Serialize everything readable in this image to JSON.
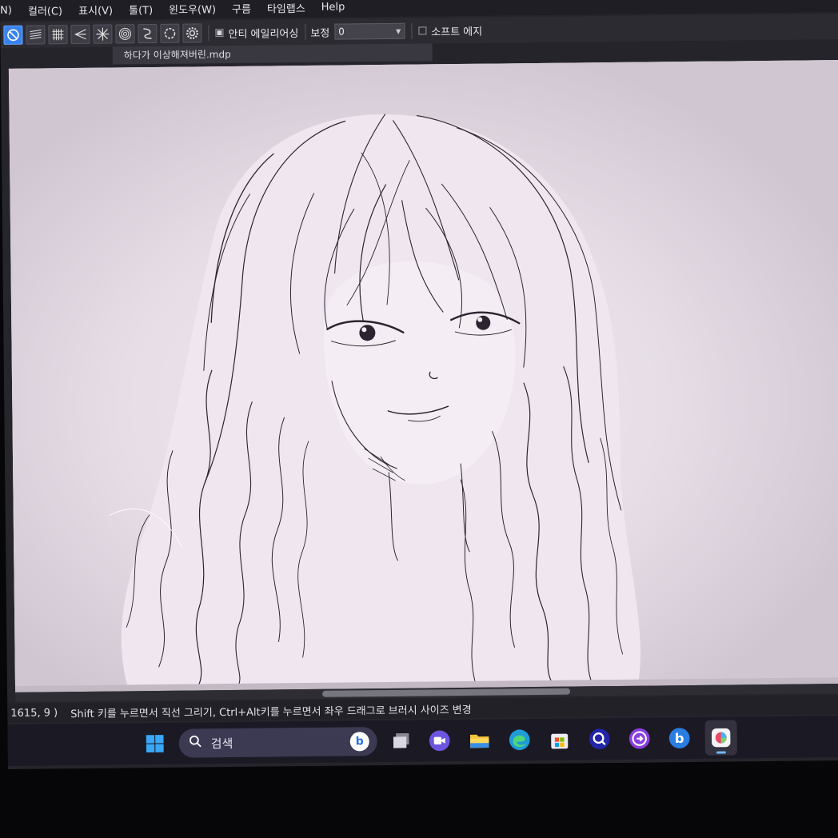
{
  "menu": {
    "items": [
      "N)",
      "컬러(C)",
      "표시(V)",
      "툴(T)",
      "윈도우(W)",
      "구름",
      "타임랩스",
      "Help"
    ]
  },
  "toolbar": {
    "antialias_label": "안티 에일리어싱",
    "antialias_checked": true,
    "correction_label": "보정",
    "correction_value": "0",
    "soft_edge_label": "소프트 에지",
    "soft_edge_checked": false,
    "tools": [
      "none-guide-icon",
      "parallel-lines-icon",
      "grid-icon",
      "perspective-icon",
      "radial-lines-icon",
      "concentric-icon",
      "curve-icon",
      "circle-icon",
      "settings-gear-icon"
    ]
  },
  "document": {
    "tab_title": "하다가 이상해져버린.mdp"
  },
  "status": {
    "coords": "1615, 9 )",
    "hint": "Shift 키를 누르면서 직선 그리기, Ctrl+Alt키를 누르면서 좌우 드래그로 브러시 사이즈 변경"
  },
  "taskbar": {
    "search_placeholder": "검색",
    "apps": [
      "windows-start-icon",
      "task-view-icon",
      "chat-camera-icon",
      "file-explorer-icon",
      "edge-browser-icon",
      "store-icon",
      "cleanup-app-icon",
      "arrow-app-icon",
      "bing-app-icon",
      "medibang-paint-icon"
    ]
  },
  "colors": {
    "canvas": "#d7cfd8",
    "toolbar_active": "#3a82ee",
    "taskbar": "#1b1a24"
  }
}
